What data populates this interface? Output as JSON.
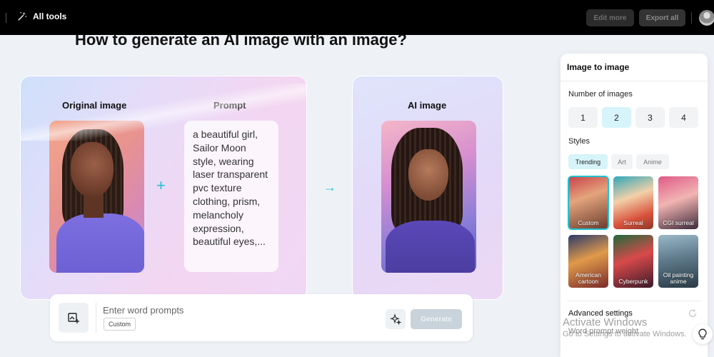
{
  "topbar": {
    "all_tools_label": "All tools",
    "edit_more_label": "Edit more",
    "export_all_label": "Export all"
  },
  "main": {
    "heading": "How to generate an AI image with an image?",
    "original_title": "Original image",
    "prompt_title": "Prompt",
    "prompt_text": "a beautiful girl, Sailor Moon style, wearing laser transparent pvc texture clothing, prism, melancholy expression, beautiful eyes,...",
    "ai_title": "AI image"
  },
  "input_bar": {
    "placeholder": "Enter word prompts",
    "chip_label": "Custom",
    "generate_label": "Generate"
  },
  "panel": {
    "title": "Image to image",
    "number_label": "Number of images",
    "numbers": [
      "1",
      "2",
      "3",
      "4"
    ],
    "selected_number": "2",
    "styles_label": "Styles",
    "style_tabs": [
      "Trending",
      "Art",
      "Anime"
    ],
    "active_tab": "Trending",
    "tiles": [
      {
        "label": "Custom",
        "selected": true
      },
      {
        "label": "Surreal",
        "selected": false
      },
      {
        "label": "CGI surreal",
        "selected": false
      },
      {
        "label": "American cartoon",
        "selected": false
      },
      {
        "label": "Cyberpunk",
        "selected": false
      },
      {
        "label": "Oil painting anime",
        "selected": false
      }
    ],
    "advanced_label": "Advanced settings",
    "word_weight_label": "Word prompt weight"
  },
  "watermark": {
    "title": "Activate Windows",
    "subtitle": "Go to Settings to activate Windows."
  },
  "colors": {
    "accent": "#1fc3d3",
    "topbar": "#000000"
  }
}
